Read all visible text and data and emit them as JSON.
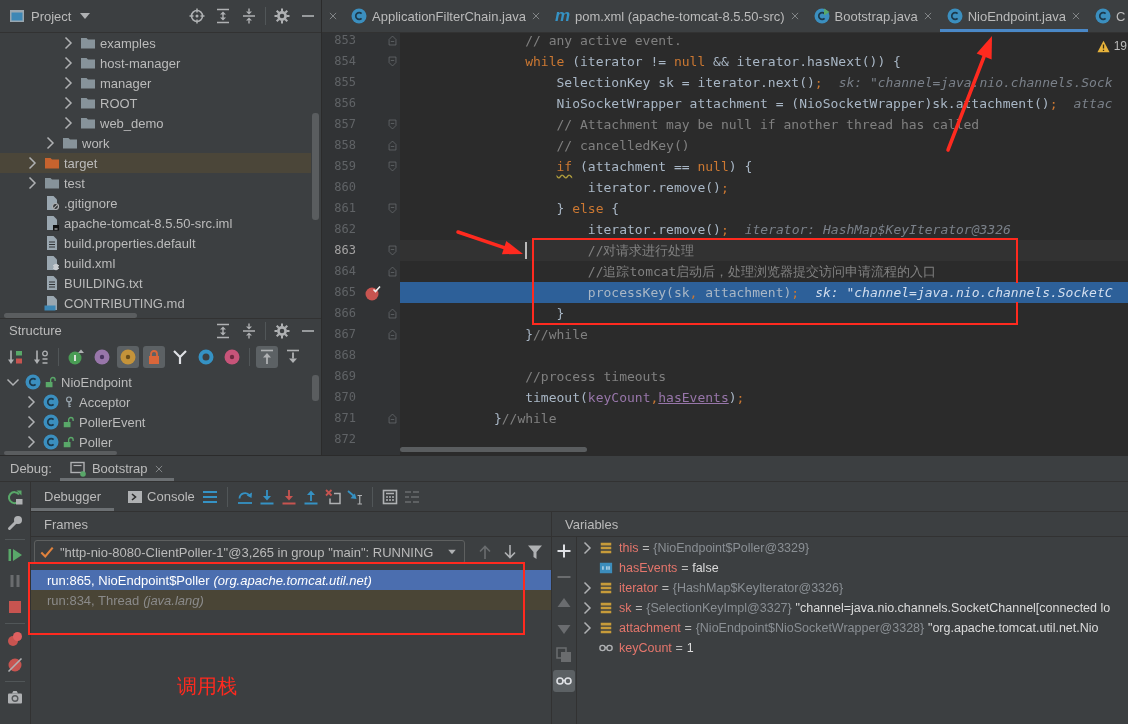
{
  "project_panel": {
    "title": "Project",
    "tree": [
      {
        "children": [
          {
            "children": [
              {
                "label": "examples",
                "kind": "folder",
                "expanded": false
              },
              {
                "label": "host-manager",
                "kind": "folder",
                "expanded": false
              },
              {
                "label": "manager",
                "kind": "folder",
                "expanded": false
              },
              {
                "label": "ROOT",
                "kind": "folder",
                "expanded": false
              },
              {
                "label": "web_demo",
                "kind": "folder",
                "expanded": false
              }
            ]
          },
          {
            "label": "work",
            "kind": "folder",
            "expanded": false
          }
        ]
      },
      {
        "label": "target",
        "kind": "excluded_folder",
        "expanded": false
      },
      {
        "label": "test",
        "kind": "folder",
        "expanded": false
      },
      {
        "label": ".gitignore",
        "kind": "ignore_file"
      },
      {
        "label": "apache-tomcat-8.5.50-src.iml",
        "kind": "module_file"
      },
      {
        "label": "build.properties.default",
        "kind": "text_file"
      },
      {
        "label": "build.xml",
        "kind": "ant_file"
      },
      {
        "label": "BUILDING.txt",
        "kind": "text_file"
      },
      {
        "label": "CONTRIBUTING.md",
        "kind": "markdown_file"
      }
    ]
  },
  "structure_panel": {
    "title": "Structure",
    "toolbar": [
      [
        {
          "kind": "sort_visibility",
          "on": false
        },
        {
          "kind": "sort_alpha",
          "on": false
        }
      ],
      [
        {
          "kind": "inherited",
          "on": false
        },
        {
          "kind": "properties",
          "on": false
        },
        {
          "kind": "fields",
          "on": true
        },
        {
          "kind": "non_public",
          "on": true
        },
        {
          "kind": "includes",
          "on": false
        },
        {
          "kind": "anonymous",
          "on": false
        },
        {
          "kind": "lambdas",
          "on": false
        }
      ],
      [
        {
          "kind": "autoscroll_to_source",
          "on": true
        },
        {
          "kind": "autoscroll_from_source",
          "on": false
        }
      ]
    ],
    "tree": [
      {
        "label": "NioEndpoint",
        "kind": "public_class",
        "expanded": true,
        "children": [
          {
            "label": "Acceptor",
            "kind": "package_class",
            "expanded": false
          },
          {
            "label": "PollerEvent",
            "kind": "public_class",
            "expanded": false
          },
          {
            "label": "Poller",
            "kind": "public_class",
            "expanded": false
          }
        ]
      }
    ]
  },
  "editor": {
    "tabs": [
      {
        "kind": "clipped",
        "selected": false
      },
      {
        "kind": "class",
        "label": "ApplicationFilterChain.java",
        "selected": false
      },
      {
        "kind": "maven",
        "glyph": "m",
        "label": "pom.xml (apache-tomcat-8.5.50-src)",
        "selected": false
      },
      {
        "kind": "runnable_class",
        "label": "Bootstrap.java",
        "selected": false
      },
      {
        "kind": "class",
        "label": "NioEndpoint.java",
        "selected": true
      },
      {
        "kind": "class",
        "label": "C",
        "selected": false
      }
    ],
    "warning_count": "19",
    "lines": [
      {
        "number": "853",
        "kind": "fold_end",
        "code": [
          {
            "kind": "comment",
            "text": "                // any active event."
          }
        ],
        "breakpoint": false,
        "caret_line": false,
        "execution_point": false
      },
      {
        "number": "854",
        "kind": "fold_start",
        "code": [
          {
            "kind": "keyword",
            "text": "                while"
          },
          {
            "kind": "plain",
            "text": " (iterator != "
          },
          {
            "kind": "keyword",
            "text": "null"
          },
          {
            "kind": "plain",
            "text": " && iterator.hasNext()) {"
          }
        ],
        "breakpoint": false,
        "caret_line": false,
        "execution_point": false
      },
      {
        "number": "855",
        "kind": "plain",
        "code": [
          {
            "kind": "plain",
            "text": "                    SelectionKey sk = iterator.next()"
          },
          {
            "kind": "keyword",
            "text": ";"
          }
        ],
        "hint": "sk: \"channel=java.nio.channels.Sock",
        "breakpoint": false,
        "caret_line": false,
        "execution_point": false
      },
      {
        "number": "856",
        "kind": "plain",
        "code": [
          {
            "kind": "plain",
            "text": "                    NioSocketWrapper attachment = (NioSocketWrapper)sk.attachment()"
          },
          {
            "kind": "keyword",
            "text": ";"
          }
        ],
        "hint": "attac",
        "breakpoint": false,
        "caret_line": false,
        "execution_point": false
      },
      {
        "number": "857",
        "kind": "fold_start",
        "code": [
          {
            "kind": "comment",
            "text": "                    // Attachment may be null if another thread has called"
          }
        ],
        "breakpoint": false,
        "caret_line": false,
        "execution_point": false
      },
      {
        "number": "858",
        "kind": "fold_end",
        "code": [
          {
            "kind": "comment",
            "text": "                    // cancelledKey()"
          }
        ],
        "breakpoint": false,
        "caret_line": false,
        "execution_point": false
      },
      {
        "number": "859",
        "kind": "fold_start",
        "code": [
          {
            "kind": "keyword_warn",
            "text": "                    if"
          },
          {
            "kind": "plain",
            "text": " (attachment == "
          },
          {
            "kind": "keyword",
            "text": "null"
          },
          {
            "kind": "plain",
            "text": ") {"
          }
        ],
        "breakpoint": false,
        "caret_line": false,
        "execution_point": false
      },
      {
        "number": "860",
        "kind": "plain",
        "code": [
          {
            "kind": "plain",
            "text": "                        iterator.remove()"
          },
          {
            "kind": "keyword",
            "text": ";"
          }
        ],
        "breakpoint": false,
        "caret_line": false,
        "execution_point": false
      },
      {
        "number": "861",
        "kind": "fold_start",
        "code": [
          {
            "kind": "plain",
            "text": "                    } "
          },
          {
            "kind": "keyword",
            "text": "else"
          },
          {
            "kind": "plain",
            "text": " {"
          }
        ],
        "breakpoint": false,
        "caret_line": false,
        "execution_point": false
      },
      {
        "number": "862",
        "kind": "plain",
        "code": [
          {
            "kind": "plain",
            "text": "                        iterator.remove()"
          },
          {
            "kind": "keyword",
            "text": ";"
          }
        ],
        "hint": "iterator: HashMap$KeyIterator@3326",
        "breakpoint": false,
        "caret_line": false,
        "execution_point": false
      },
      {
        "number": "863",
        "kind": "fold_start",
        "code": [
          {
            "kind": "comment",
            "text": "                        //对请求进行处理"
          }
        ],
        "breakpoint": false,
        "caret_line": true,
        "execution_point": false
      },
      {
        "number": "864",
        "kind": "fold_end",
        "code": [
          {
            "kind": "comment",
            "text": "                        //追踪tomcat启动后，处理浏览器提交访问申请流程的入口"
          }
        ],
        "breakpoint": false,
        "caret_line": false,
        "execution_point": false
      },
      {
        "number": "865",
        "kind": "plain",
        "code": [
          {
            "kind": "plain",
            "text": "                        processKey(sk"
          },
          {
            "kind": "keyword",
            "text": ","
          },
          {
            "kind": "plain",
            "text": " attachment)"
          },
          {
            "kind": "keyword",
            "text": ";"
          }
        ],
        "hint": "sk: \"channel=java.nio.channels.SocketC",
        "breakpoint": true,
        "caret_line": false,
        "execution_point": true
      },
      {
        "number": "866",
        "kind": "fold_end",
        "code": [
          {
            "kind": "plain",
            "text": "                    }"
          }
        ],
        "breakpoint": false,
        "caret_line": false,
        "execution_point": false
      },
      {
        "number": "867",
        "kind": "fold_end",
        "code": [
          {
            "kind": "plain",
            "text": "                }"
          },
          {
            "kind": "comment",
            "text": "//while"
          }
        ],
        "breakpoint": false,
        "caret_line": false,
        "execution_point": false
      },
      {
        "number": "868",
        "kind": "plain",
        "breakpoint": false,
        "caret_line": false,
        "execution_point": false
      },
      {
        "number": "869",
        "kind": "plain",
        "code": [
          {
            "kind": "comment",
            "text": "                //process timeouts"
          }
        ],
        "breakpoint": false,
        "caret_line": false,
        "execution_point": false
      },
      {
        "number": "870",
        "kind": "plain",
        "code": [
          {
            "kind": "plain",
            "text": "                timeout("
          },
          {
            "kind": "field",
            "text": "keyCount"
          },
          {
            "kind": "keyword",
            "text": ","
          },
          {
            "kind": "field_ref",
            "text": "hasEvents"
          },
          {
            "kind": "plain",
            "text": ")"
          },
          {
            "kind": "keyword",
            "text": ";"
          }
        ],
        "breakpoint": false,
        "caret_line": false,
        "execution_point": false
      },
      {
        "number": "871",
        "kind": "fold_end",
        "code": [
          {
            "kind": "plain",
            "text": "            }"
          },
          {
            "kind": "comment",
            "text": "//while"
          }
        ],
        "breakpoint": false,
        "caret_line": false,
        "execution_point": false
      },
      {
        "number": "872",
        "kind": "plain",
        "breakpoint": false,
        "caret_line": false,
        "execution_point": false
      }
    ]
  },
  "debug": {
    "title": "Debug:",
    "sessions": [
      {
        "label": "Bootstrap",
        "selected": true
      }
    ],
    "side_toolbar": [
      [
        {
          "kind": "rerun",
          "disabled": false
        },
        {
          "kind": "settings",
          "disabled": false
        }
      ],
      [
        {
          "kind": "resume",
          "disabled": false
        },
        {
          "kind": "pause",
          "disabled": true
        },
        {
          "kind": "stop",
          "disabled": false
        }
      ],
      [
        {
          "kind": "view_breakpoints",
          "disabled": false
        },
        {
          "kind": "mute_breakpoints",
          "disabled": false
        }
      ],
      [
        {
          "kind": "snapshot",
          "disabled": false
        }
      ]
    ],
    "tabs": [
      {
        "kind": "debugger",
        "label": "Debugger",
        "selected": true
      },
      {
        "kind": "console",
        "label": "Console",
        "selected": false
      }
    ],
    "toolbar": [
      [
        {
          "kind": "show_execution_point",
          "disabled": false
        }
      ],
      [
        {
          "kind": "step_over",
          "disabled": false
        },
        {
          "kind": "step_into",
          "disabled": false
        },
        {
          "kind": "force_step_into",
          "disabled": false
        },
        {
          "kind": "step_out",
          "disabled": false
        },
        {
          "kind": "drop_frame",
          "disabled": false
        },
        {
          "kind": "run_to_cursor",
          "disabled": false
        }
      ],
      [
        {
          "kind": "evaluate",
          "disabled": false
        },
        {
          "kind": "trace",
          "disabled": true
        }
      ]
    ],
    "frames": {
      "title": "Frames",
      "thread": "\"http-nio-8080-ClientPoller-1\"@3,265 in group \"main\": RUNNING",
      "nav": [
        {
          "kind": "previous",
          "disabled": true
        },
        {
          "kind": "next",
          "disabled": false
        },
        {
          "kind": "filter",
          "disabled": false
        }
      ],
      "items": [
        {
          "method": "run:865, NioEndpoint$Poller",
          "package": "(org.apache.tomcat.util.net)",
          "selected": true,
          "library": false
        },
        {
          "method": "run:834, Thread",
          "package": "(java.lang)",
          "selected": false,
          "library": true
        }
      ]
    },
    "variables": {
      "title": "Variables",
      "toolbar": [
        {
          "kind": "add",
          "disabled": false,
          "on": false
        },
        {
          "kind": "remove",
          "disabled": true,
          "on": false
        },
        {
          "kind": "move_up",
          "disabled": true,
          "on": false
        },
        {
          "kind": "move_down",
          "disabled": true,
          "on": false
        },
        {
          "kind": "copy",
          "disabled": true,
          "on": false
        },
        {
          "kind": "watches",
          "disabled": false,
          "on": true
        }
      ],
      "items": [
        {
          "kind": "object",
          "name": "this",
          "sign": "=",
          "ref": "{NioEndpoint$Poller@3329}",
          "expanded": false
        },
        {
          "kind": "primitive",
          "name": "hasEvents",
          "sign": "=",
          "value": "false"
        },
        {
          "kind": "object",
          "name": "iterator",
          "sign": "=",
          "ref": "{HashMap$KeyIterator@3326}",
          "expanded": false
        },
        {
          "kind": "object",
          "name": "sk",
          "sign": "=",
          "ref": "{SelectionKeyImpl@3327}",
          "value": "\"channel=java.nio.channels.SocketChannel[connected lo",
          "expanded": false
        },
        {
          "kind": "object",
          "name": "attachment",
          "sign": "=",
          "ref": "{NioEndpoint$NioSocketWrapper@3328}",
          "value": "\"org.apache.tomcat.util.net.Nio",
          "expanded": false
        },
        {
          "kind": "watch",
          "name": "keyCount",
          "sign": "=",
          "value": "1"
        }
      ]
    }
  },
  "annotation_label": "调用栈"
}
